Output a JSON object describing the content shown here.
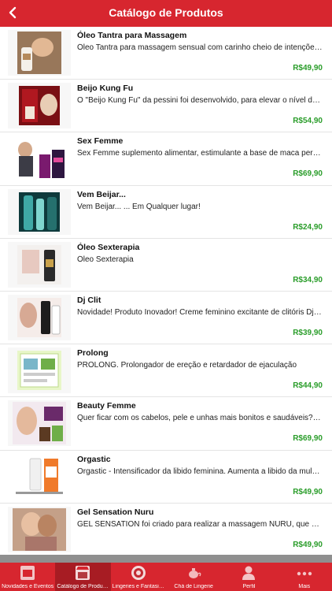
{
  "header": {
    "title": "Catálogo de Produtos",
    "back_icon": "chevron-left-icon"
  },
  "colors": {
    "brand": "#d7262f",
    "price": "#2a9d2a",
    "active_tab": "#a71c23"
  },
  "products": [
    {
      "name": "Óleo Tantra para Massagem",
      "description": "Óleo Tantra para massagem sensual com carinho cheio de intenções e toques",
      "price": "R$49,90"
    },
    {
      "name": "Beijo Kung Fu",
      "description": "O \"Beijo Kung Fu\" da pessini foi desenvolvido, para elevar o nível do beijo",
      "price": "R$54,90"
    },
    {
      "name": "Sex Femme",
      "description": "Sex Femme suplemento alimentar, estimulante a base de maca peruana",
      "price": "R$69,90"
    },
    {
      "name": "Vem Beijar...",
      "description": "Vem Beijar... ... Em Qualquer lugar!",
      "price": "R$24,90"
    },
    {
      "name": "Óleo Sexterapia",
      "description": "Óleo Sexterapia",
      "price": "R$34,90"
    },
    {
      "name": "Dj Clit",
      "description": "Novidade! Produto Inovador! Creme feminino excitante de clitóris Dj Clit",
      "price": "R$39,90"
    },
    {
      "name": "Prolong",
      "description": "PROLONG. Prolongador de ereção e retardador de ejaculação",
      "price": "R$44,90"
    },
    {
      "name": "Beauty Femme",
      "description": "Quer ficar com os cabelos, pele e unhas mais bonitos e saudáveis? Beauty",
      "price": "R$69,90"
    },
    {
      "name": "Orgastic",
      "description": "Orgastic - Intensificador da libido feminina. Aumenta a libido da mulher",
      "price": "R$49,90"
    },
    {
      "name": "Gel Sensation Nuru",
      "description": "GEL SENSATION foi criado para realizar a massagem NURU, que envolve",
      "price": "R$49,90"
    }
  ],
  "tabs": [
    {
      "label": "Novidades e Eventos",
      "icon": "store-badge-icon"
    },
    {
      "label": "Catálogo de Produtos",
      "icon": "shop-awning-icon"
    },
    {
      "label": "Lingeries e Fantasias",
      "icon": "lingerie-badge-icon"
    },
    {
      "label": "Chá de Lingerie",
      "icon": "teapot-icon"
    },
    {
      "label": "Perfil",
      "icon": "user-icon"
    },
    {
      "label": "Mais",
      "icon": "more-dots-icon"
    }
  ]
}
